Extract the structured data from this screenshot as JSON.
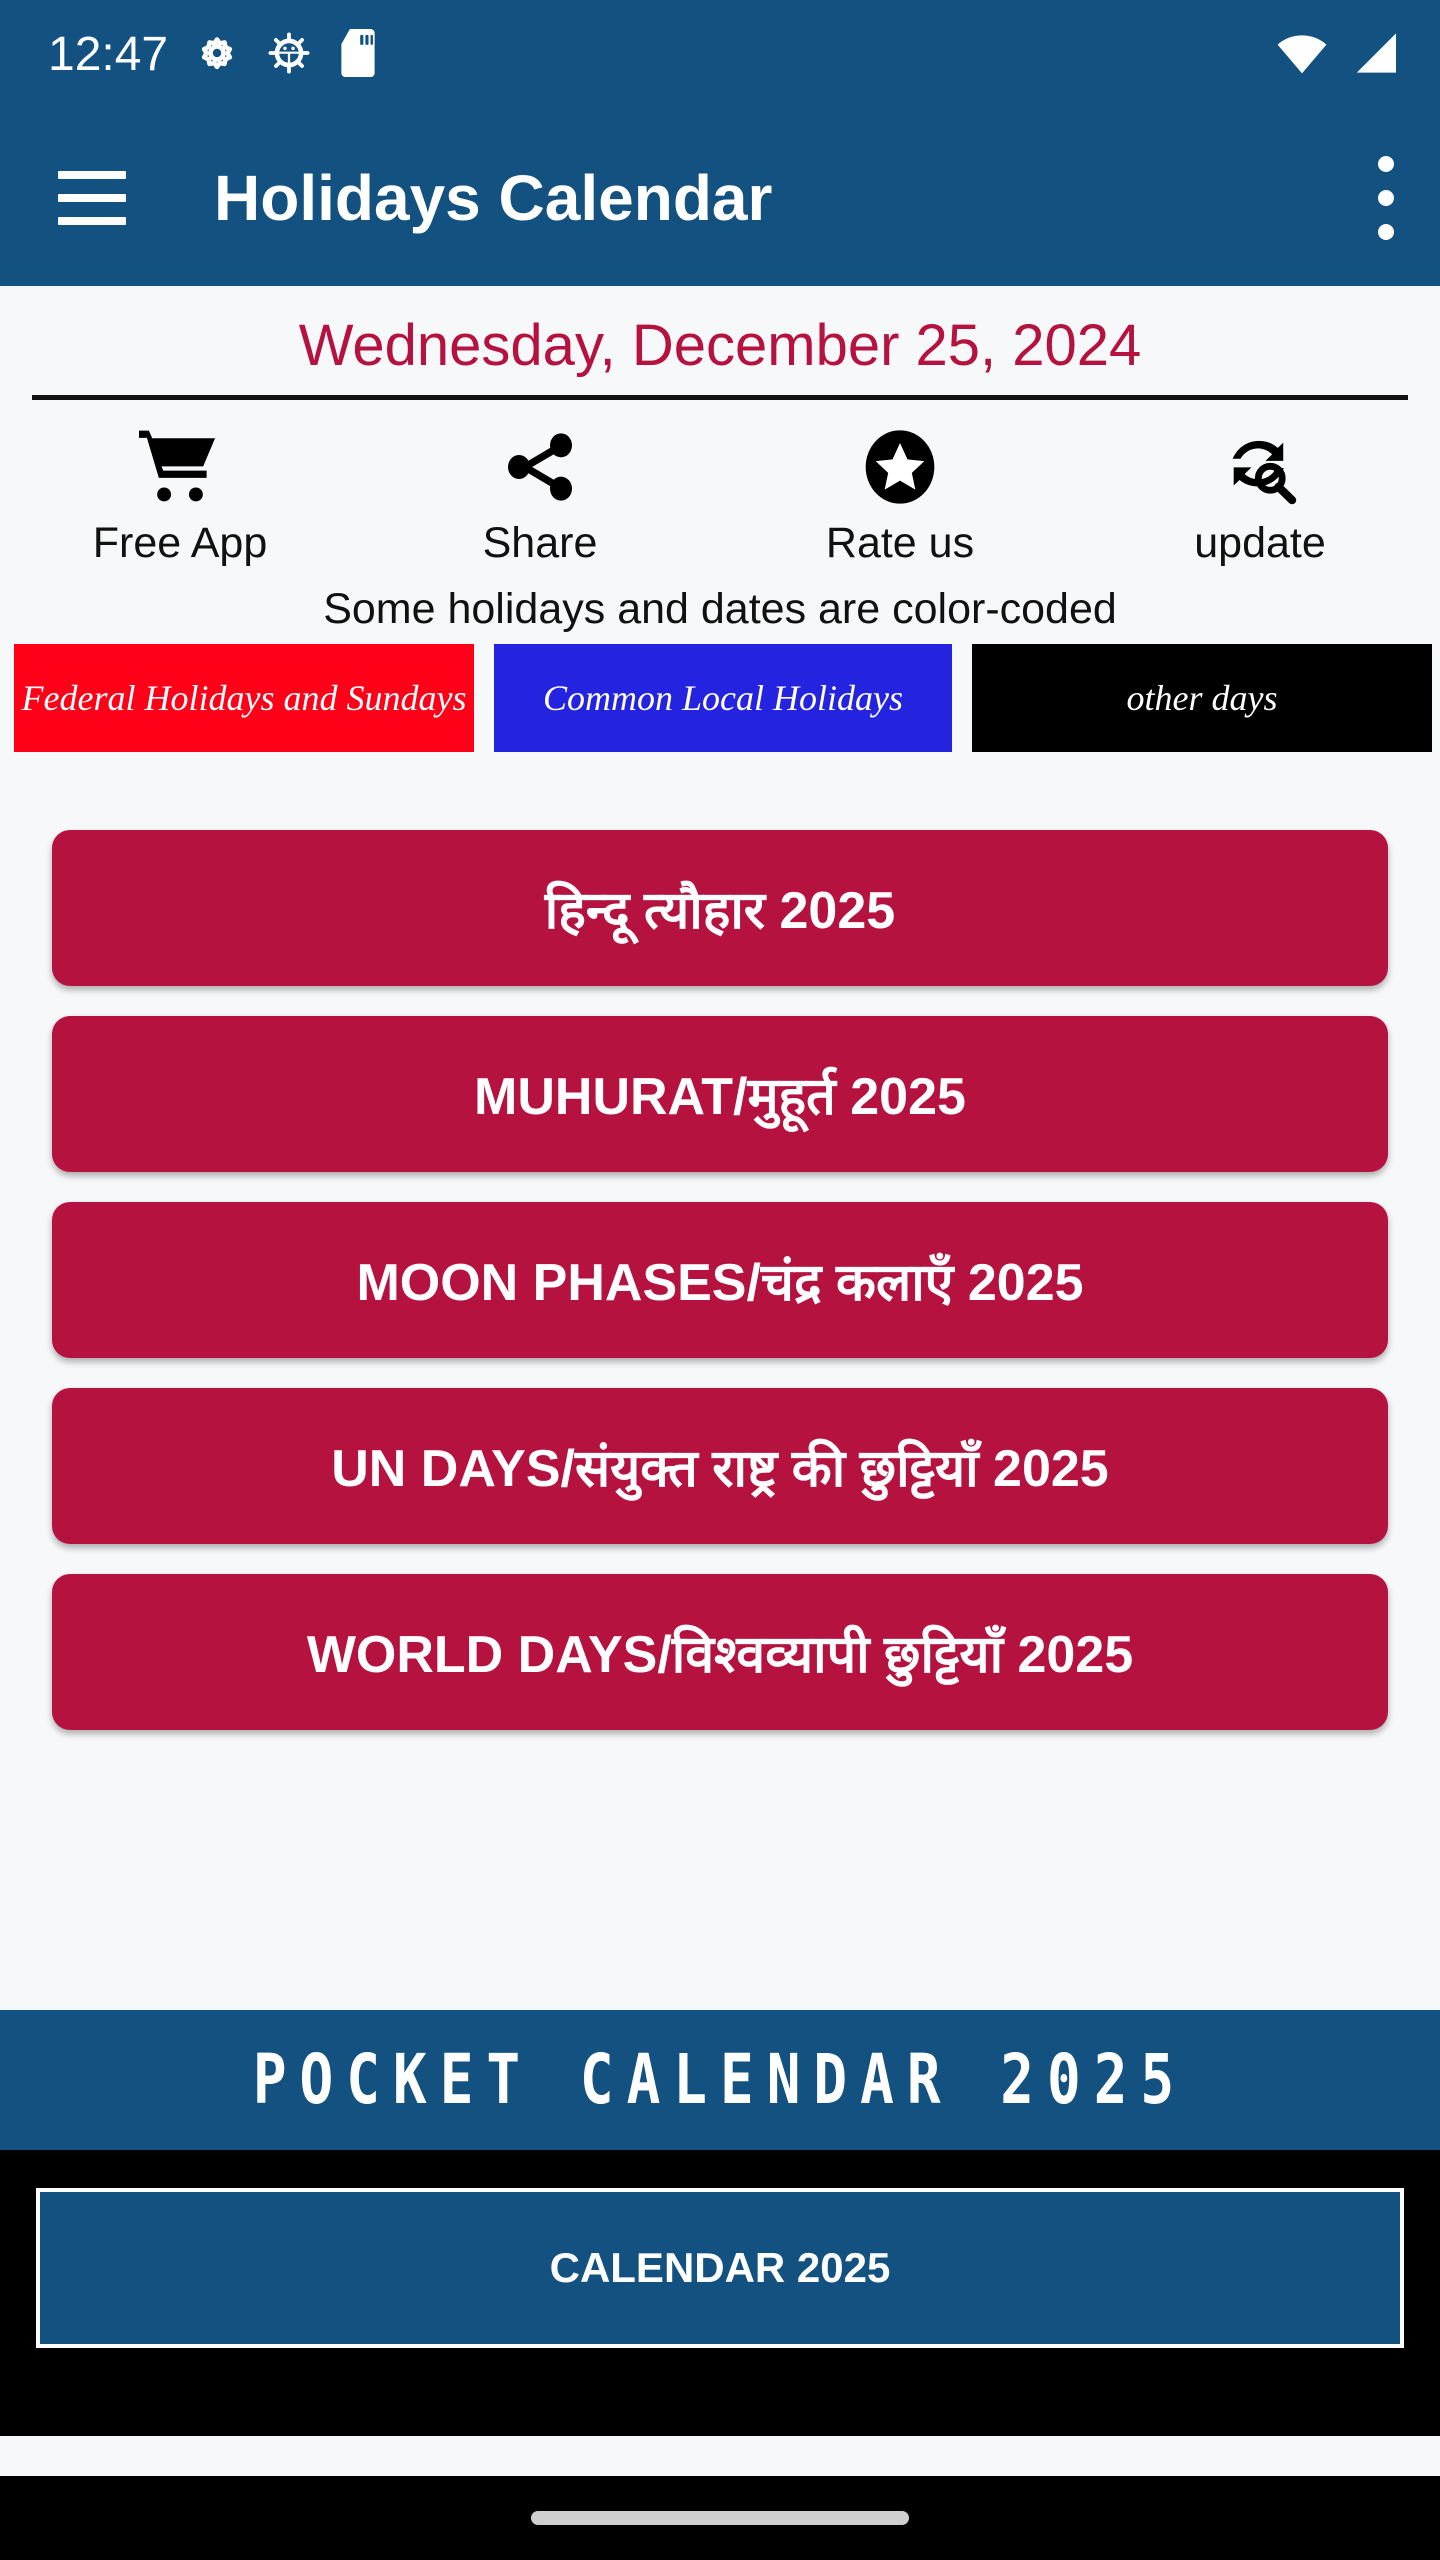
{
  "status_bar": {
    "clock": "12:47",
    "left_icons": [
      "gear-icon",
      "android-bug-icon",
      "sd-card-icon"
    ],
    "right_icons": [
      "wifi-icon",
      "cellular-signal-icon"
    ]
  },
  "app_bar": {
    "menu_icon": "hamburger-menu-icon",
    "title": "Holidays Calendar",
    "overflow_icon": "more-vertical-icon",
    "background_color": "#125180"
  },
  "header": {
    "current_date": "Wednesday, December 25, 2024",
    "date_color": "#b5123f"
  },
  "actions": [
    {
      "label": "Free App",
      "icon": "shopping-cart-icon"
    },
    {
      "label": "Share",
      "icon": "share-icon"
    },
    {
      "label": "Rate us",
      "icon": "star-circle-icon"
    },
    {
      "label": "update",
      "icon": "refresh-search-icon"
    }
  ],
  "legend": {
    "note": "Some holidays and dates are color-coded",
    "items": [
      {
        "label": "Federal Holidays and Sundays",
        "color": "#ff0018"
      },
      {
        "label": "Common Local Holidays",
        "color": "#2424e0"
      },
      {
        "label": "other days",
        "color": "#000000"
      }
    ]
  },
  "menu": {
    "button_color": "#b5123f",
    "buttons": [
      {
        "label": "हिन्दू त्यौहार 2025"
      },
      {
        "label": "MUHURAT/मुहूर्त 2025"
      },
      {
        "label": "MOON PHASES/चंद्र कलाएँ 2025"
      },
      {
        "label": "UN DAYS/संयुक्त राष्ट्र की छुट्टियाँ 2025"
      },
      {
        "label": "WORLD DAYS/विश्वव्यापी छुट्टियाँ 2025"
      }
    ]
  },
  "bottom": {
    "banner_text": "POCKET CALENDAR 2025",
    "banner_color": "#125180",
    "calendar_button_label": "CALENDAR 2025"
  },
  "nav_bar": {
    "gesture_pill": "home-gesture-pill"
  }
}
